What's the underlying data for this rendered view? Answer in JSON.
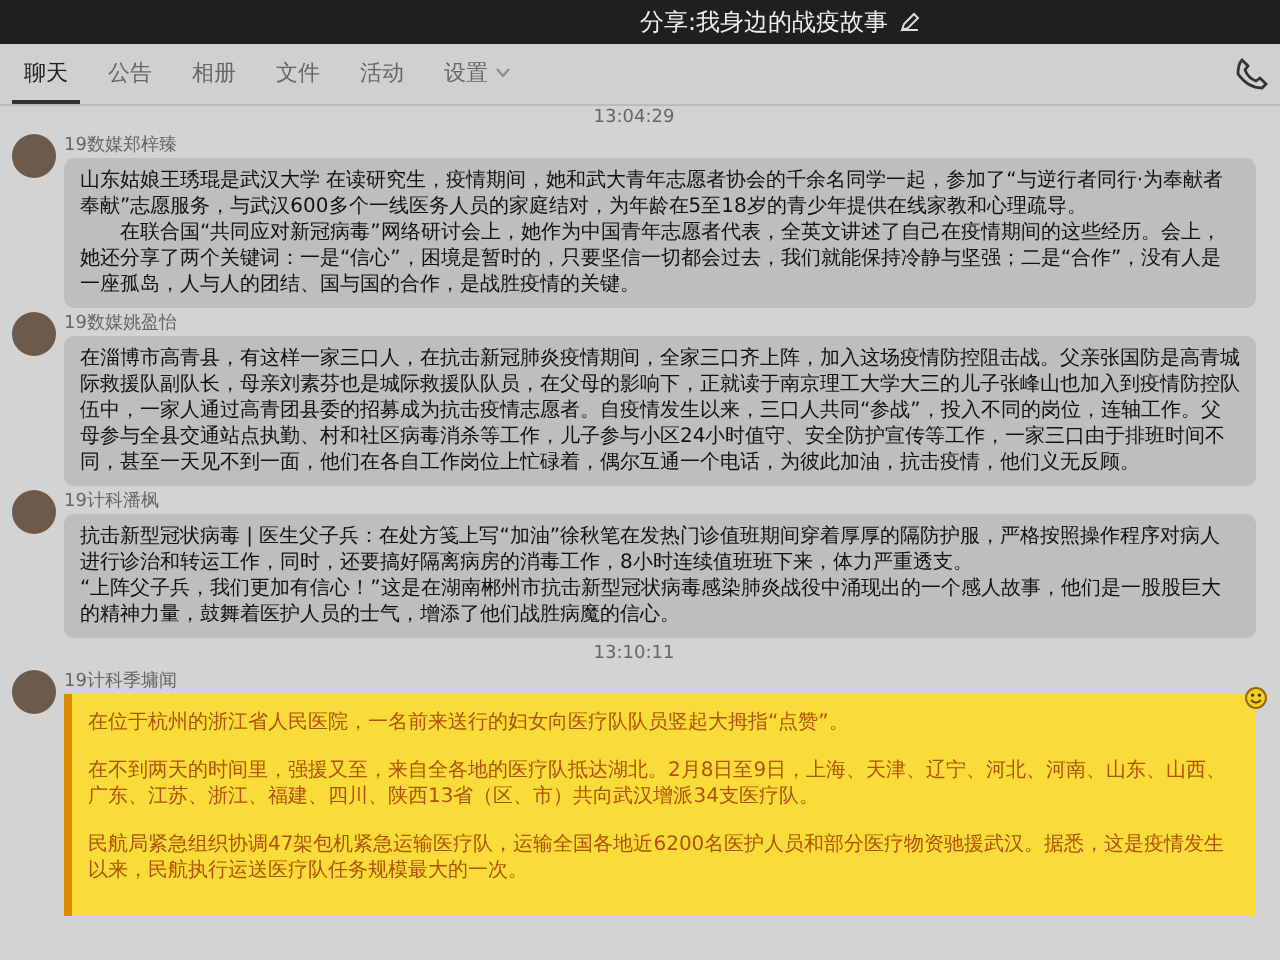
{
  "window": {
    "title": "分享:我身边的战疫故事"
  },
  "tabs": [
    {
      "label": "聊天",
      "selected": true,
      "dropdown": false
    },
    {
      "label": "公告",
      "selected": false,
      "dropdown": false
    },
    {
      "label": "相册",
      "selected": false,
      "dropdown": false
    },
    {
      "label": "文件",
      "selected": false,
      "dropdown": false
    },
    {
      "label": "活动",
      "selected": false,
      "dropdown": false
    },
    {
      "label": "设置",
      "selected": false,
      "dropdown": true
    }
  ],
  "messages": [
    {
      "kind": "time",
      "text": "13:04:29"
    },
    {
      "kind": "normal",
      "sender": "19数媒郑梓臻",
      "paragraphs": [
        {
          "text": "山东姑娘王琇琨是武汉大学 在读研究生，疫情期间，她和武大青年志愿者协会的千余名同学一起，参加了“与逆行者同行·为奉献者奉献”志愿服务，与武汉600多个一线医务人员的家庭结对，为年龄在5至18岁的青少年提供在线家教和心理疏导。",
          "indent": false
        },
        {
          "text": "在联合国“共同应对新冠病毒”网络研讨会上，她作为中国青年志愿者代表，全英文讲述了自己在疫情期间的这些经历。会上，她还分享了两个关键词：一是“信心”，困境是暂时的，只要坚信一切都会过去，我们就能保持冷静与坚强；二是“合作”，没有人是一座孤岛，人与人的团结、国与国的合作，是战胜疫情的关键。",
          "indent": true
        }
      ]
    },
    {
      "kind": "normal",
      "sender": "19数媒姚盈怡",
      "paragraphs": [
        {
          "text": "在淄博市高青县，有这样一家三口人，在抗击新冠肺炎疫情期间，全家三口齐上阵，加入这场疫情防控阻击战。父亲张国防是高青城际救援队副队长，母亲刘素芬也是城际救援队队员，在父母的影响下，正就读于南京理工大学大三的儿子张峰山也加入到疫情防控队伍中，一家人通过高青团县委的招募成为抗击疫情志愿者。自疫情发生以来，三口人共同“参战”，投入不同的岗位，连轴工作。父母参与全县交通站点执勤、村和社区病毒消杀等工作，儿子参与小区24小时值守、安全防护宣传等工作，一家三口由于排班时间不同，甚至一天见不到一面，他们在各自工作岗位上忙碌着，偶尔互通一个电话，为彼此加油，抗击疫情，他们义无反顾。",
          "indent": false
        }
      ]
    },
    {
      "kind": "normal",
      "sender": "19计科潘枫",
      "paragraphs": [
        {
          "text": "抗击新型冠状病毒 | 医生父子兵：在处方笺上写“加油”徐秋笔在发热门诊值班期间穿着厚厚的隔防护服，严格按照操作程序对病人进行诊治和转运工作，同时，还要搞好隔离病房的消毒工作，8小时连续值班班下来，体力严重透支。",
          "indent": false
        },
        {
          "text": "“上阵父子兵，我们更加有信心！”这是在湖南郴州市抗击新型冠状病毒感染肺炎战役中涌现出的一个感人故事，他们是一股股巨大的精神力量，鼓舞着医护人员的士气，增添了他们战胜病魔的信心。",
          "indent": false
        }
      ]
    },
    {
      "kind": "time",
      "text": "13:10:11"
    },
    {
      "kind": "highlight",
      "sender": "19计科季墉闻",
      "paragraphs": [
        {
          "text": "在位于杭州的浙江省人民医院，一名前来送行的妇女向医疗队队员竖起大拇指“点赞”。",
          "indent": false
        },
        {
          "text": "在不到两天的时间里，强援又至，来自全各地的医疗队抵达湖北。2月8日至9日，上海、天津、辽宁、河北、河南、山东、山西、广东、江苏、浙江、福建、四川、陕西13省（区、市）共向武汉增派34支医疗队。",
          "indent": false
        },
        {
          "text": "民航局紧急组织协调47架包机紧急运输医疗队，运输全国各地近6200名医护人员和部分医疗物资驰援武汉。据悉，这是疫情发生以来，民航执行运送医疗队任务规模最大的一次。",
          "indent": false
        }
      ]
    }
  ]
}
